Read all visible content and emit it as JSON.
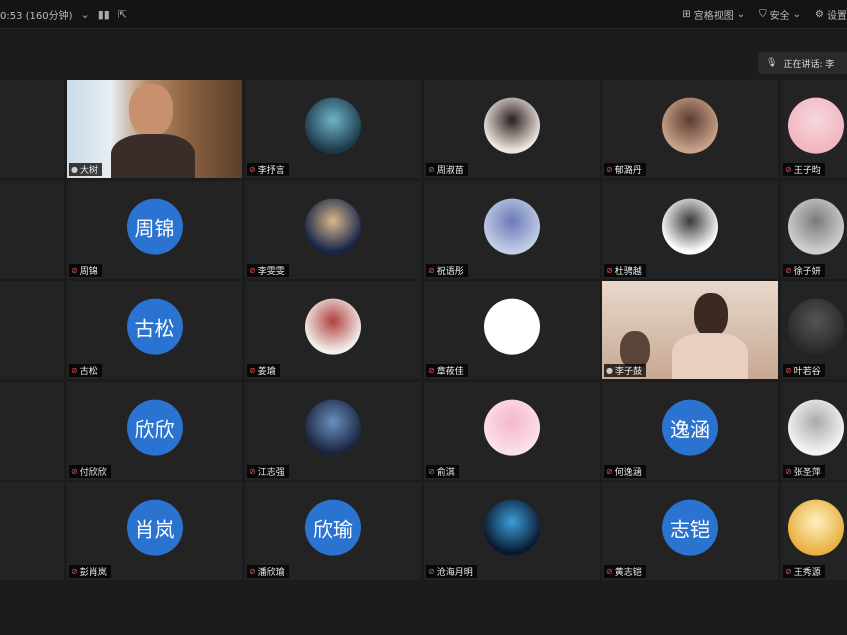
{
  "topbar": {
    "timer": "0:53 (160分钟)",
    "grid_view_label": "宫格视图",
    "security_label": "安全",
    "settings_label": "设置"
  },
  "speaking_label": "正在讲话: 李",
  "participants": [
    {
      "name": "大树",
      "kind": "video",
      "muted": false
    },
    {
      "name": "李抒言",
      "kind": "photo",
      "muted": true,
      "colors": [
        "#1d3b4c",
        "#6fb4c8"
      ]
    },
    {
      "name": "周淑苗",
      "kind": "photo",
      "muted": true,
      "colors": [
        "#f0e6df",
        "#2a2020"
      ]
    },
    {
      "name": "郁潞丹",
      "kind": "photo",
      "muted": true,
      "colors": [
        "#c9a28a",
        "#5a3c30"
      ]
    },
    {
      "name": "王子昀",
      "kind": "photo",
      "muted": true,
      "colors": [
        "#f2b6c0",
        "#f7d8de"
      ]
    },
    {
      "name": "周锦",
      "kind": "text",
      "initials": "周锦",
      "muted": true
    },
    {
      "name": "李雯雯",
      "kind": "photo",
      "muted": true,
      "colors": [
        "#16254a",
        "#d9b88a"
      ]
    },
    {
      "name": "祝语彤",
      "kind": "photo",
      "muted": true,
      "colors": [
        "#c2cde6",
        "#6a79b8"
      ]
    },
    {
      "name": "杜骋越",
      "kind": "photo",
      "muted": true,
      "colors": [
        "#ffffff",
        "#3a3a3a"
      ]
    },
    {
      "name": "徐子妍",
      "kind": "photo",
      "muted": true,
      "colors": [
        "#cfcfcf",
        "#7a7a7a"
      ]
    },
    {
      "name": "古松",
      "kind": "text",
      "initials": "古松",
      "muted": true
    },
    {
      "name": "姜瑜",
      "kind": "photo",
      "muted": true,
      "colors": [
        "#f2f0ec",
        "#b04040"
      ]
    },
    {
      "name": "章莜佳",
      "kind": "photo",
      "muted": true,
      "colors": [
        "#ffffff",
        "#ffffff"
      ]
    },
    {
      "name": "李子鼓",
      "kind": "video2",
      "muted": false
    },
    {
      "name": "叶若谷",
      "kind": "photo",
      "muted": true,
      "colors": [
        "#2a2a2a",
        "#555555"
      ]
    },
    {
      "name": "付欣欣",
      "kind": "text",
      "initials": "欣欣",
      "muted": true
    },
    {
      "name": "江志强",
      "kind": "photo",
      "muted": true,
      "colors": [
        "#1a2540",
        "#6b8fc0"
      ]
    },
    {
      "name": "俞淇",
      "kind": "photo",
      "muted": true,
      "colors": [
        "#fbe0ea",
        "#f5b7c9"
      ]
    },
    {
      "name": "何逸涵",
      "kind": "text",
      "initials": "逸涵",
      "muted": true
    },
    {
      "name": "张圣萍",
      "kind": "photo",
      "muted": true,
      "colors": [
        "#f4f4f4",
        "#aaaaaa"
      ]
    },
    {
      "name": "彭肖岚",
      "kind": "text",
      "initials": "肖岚",
      "muted": true
    },
    {
      "name": "潘欣瑜",
      "kind": "text",
      "initials": "欣瑜",
      "muted": true
    },
    {
      "name": "沧海月明",
      "kind": "photo",
      "muted": true,
      "colors": [
        "#0a1830",
        "#3aa0d8"
      ]
    },
    {
      "name": "黄志铠",
      "kind": "text",
      "initials": "志铠",
      "muted": true
    },
    {
      "name": "王秀源",
      "kind": "photo",
      "muted": true,
      "colors": [
        "#e8b040",
        "#fff0c0"
      ]
    }
  ],
  "colors": {
    "background": "#1c1c1c",
    "tile": "#232323",
    "text_avatar": "#2b73d0",
    "active_border": "#2fc38c",
    "muted_mic": "#e05050"
  }
}
